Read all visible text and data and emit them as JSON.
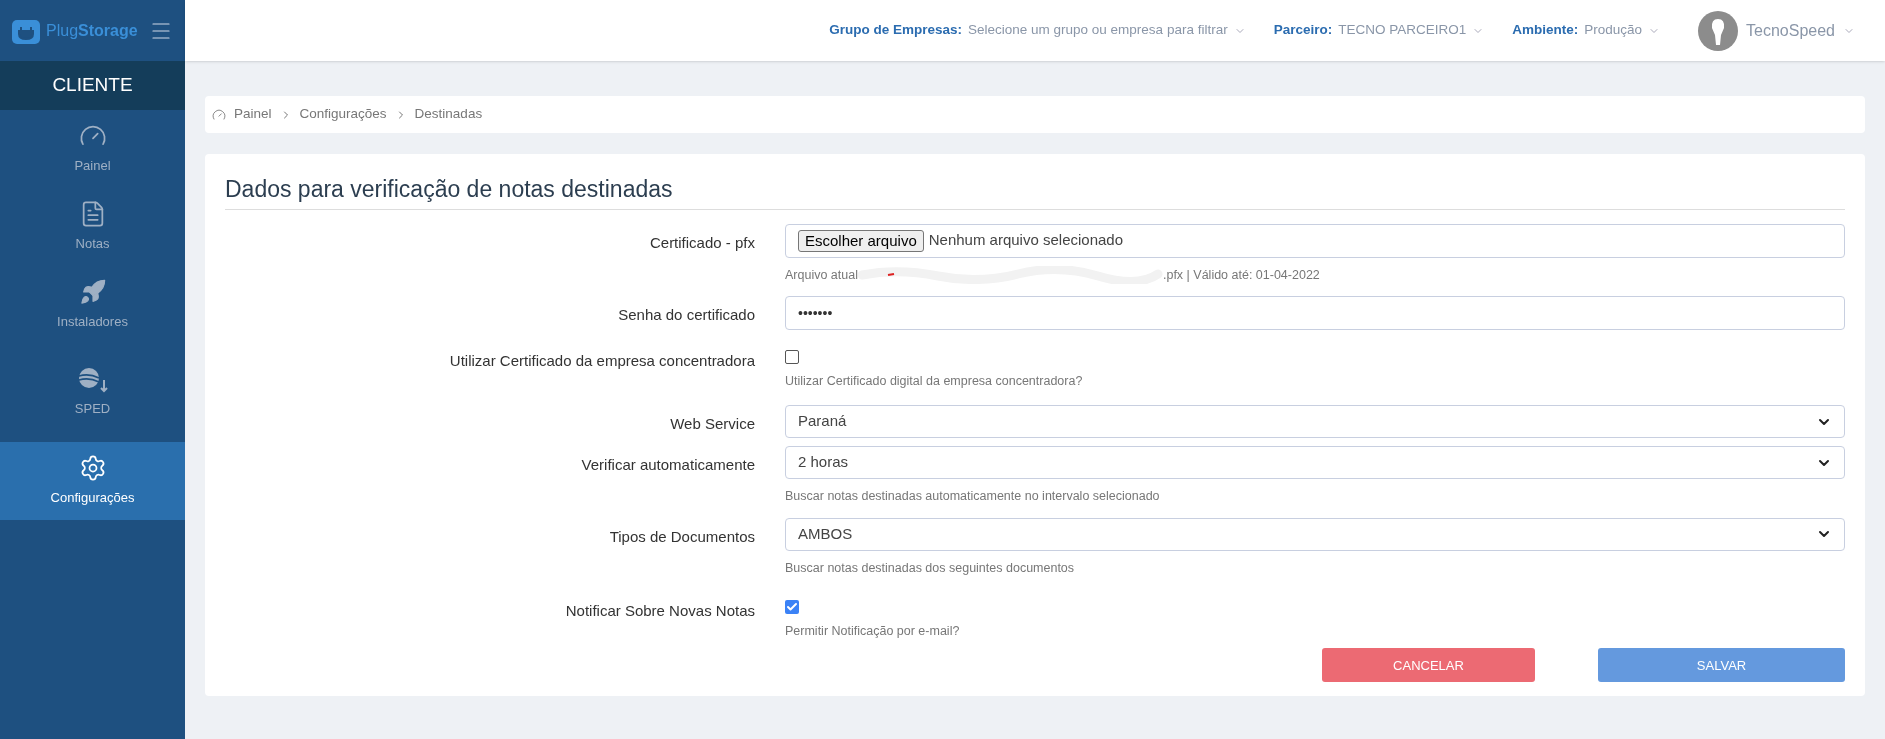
{
  "brand": {
    "light": "Plug",
    "bold": "Storage"
  },
  "sidebar": {
    "section": "CLIENTE",
    "items": [
      {
        "label": "Painel",
        "kind": "gauge",
        "selected": false
      },
      {
        "label": "Notas",
        "kind": "file",
        "selected": false
      },
      {
        "label": "Instaladores",
        "kind": "rocket",
        "selected": false
      },
      {
        "label": "SPED",
        "kind": "sped",
        "selected": false
      },
      {
        "label": "Configurações",
        "kind": "gear",
        "selected": true
      }
    ]
  },
  "topbar": {
    "filters": [
      {
        "label": "Grupo de Empresas:",
        "value": "Selecione um grupo ou empresa para filtrar"
      },
      {
        "label": "Parceiro:",
        "value": "TECNO PARCEIRO1"
      },
      {
        "label": "Ambiente:",
        "value": "Produção"
      }
    ],
    "user": "TecnoSpeed"
  },
  "breadcrumb": [
    "Painel",
    "Configurações",
    "Destinadas"
  ],
  "form": {
    "title": "Dados para verificação de notas destinadas",
    "fields": [
      {
        "kind": "file",
        "label": "Certificado - pfx",
        "button": "Escolher arquivo",
        "value": "Nenhum arquivo selecionado",
        "help_start": "Arquivo atual",
        "help_end": ".pfx | Válido até: 01-04-2022"
      },
      {
        "kind": "password",
        "label": "Senha do certificado",
        "value": "•••••••"
      },
      {
        "kind": "checkbox",
        "label": "Utilizar Certificado da empresa concentradora",
        "checked": false,
        "help": "Utilizar Certificado digital da empresa concentradora?"
      },
      {
        "kind": "select",
        "label": "Web Service",
        "value": "Paraná"
      },
      {
        "kind": "select",
        "label": "Verificar automaticamente",
        "value": "2 horas",
        "help": "Buscar notas destinadas automaticamente no intervalo selecionado"
      },
      {
        "kind": "select",
        "label": "Tipos de Documentos",
        "value": "AMBOS",
        "help": "Buscar notas destinadas dos seguintes documentos"
      },
      {
        "kind": "checkbox",
        "label": "Notificar Sobre Novas Notas",
        "checked": true,
        "help": "Permitir Notificação por e-mail?"
      }
    ],
    "buttons": [
      {
        "label": "CANCELAR",
        "kind": "cancel"
      },
      {
        "label": "SALVAR",
        "kind": "save"
      }
    ]
  }
}
